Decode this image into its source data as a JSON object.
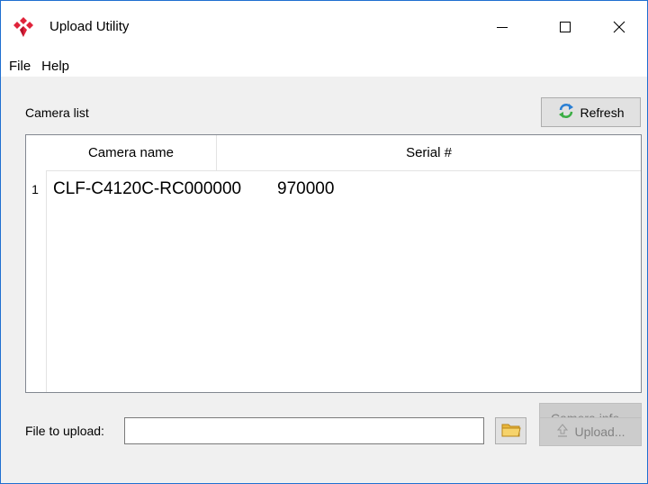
{
  "window": {
    "title": "Upload Utility",
    "accent_color": "#1f6fd0",
    "logo_color": "#e0233a"
  },
  "titlebar_icons": {
    "app": "app-logo-icon",
    "minimize": "minimize-icon",
    "maximize": "maximize-icon",
    "close": "close-icon"
  },
  "menu": {
    "items": [
      {
        "label": "File"
      },
      {
        "label": "Help"
      }
    ]
  },
  "camera_list": {
    "label": "Camera list",
    "refresh_label": "Refresh",
    "refresh_icon": "refresh-icon",
    "columns": [
      {
        "label": "Camera name"
      },
      {
        "label": "Serial #"
      }
    ],
    "rows": [
      {
        "index": "1",
        "name": "CLF-C4120C-RC000000",
        "serial": "970000"
      }
    ]
  },
  "camera_info": {
    "label": "Camera info...",
    "enabled": false
  },
  "upload": {
    "file_label": "File to upload:",
    "file_value": "",
    "browse_icon": "folder-icon",
    "upload_label": "Upload...",
    "upload_icon": "upload-icon",
    "enabled": false
  }
}
